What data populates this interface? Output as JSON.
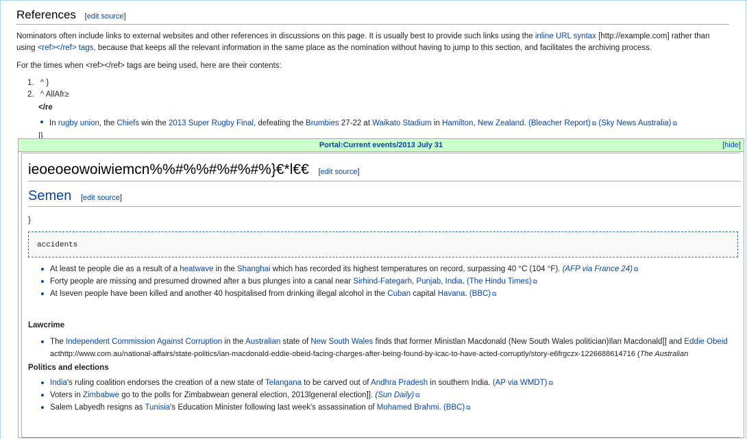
{
  "references": {
    "heading": "References",
    "edit_open": "[",
    "edit_label": "edit source",
    "edit_close": "]",
    "para1_a": "Nominators often include links to external websites and other references in discussions on this page. It is usually best to provide such links using the ",
    "para1_link1": "inline URL syntax",
    "para1_b": " [http://example.com] rather than using ",
    "para1_link2": "<ref></ref> tags",
    "para1_c": ", because that keeps all the relevant information in the same place as the nomination without having to jump to this section, and facilitates the archiving process.",
    "para2": "For the times when <ref></ref> tags are being used, here are their contents:",
    "ref1_num": "1.",
    "ref1_caret": "^",
    "ref1_text": " }",
    "ref2_num": "2.",
    "ref2_caret": "^",
    "ref2_text": " AllAfr≥",
    "ref2_bold": "</re",
    "bullet_a": "In ",
    "bullet_l1": "rugby union",
    "bullet_b": ", the ",
    "bullet_l2": "Chiefs",
    "bullet_c": " win the ",
    "bullet_l3": "2013 Super Rugby Final",
    "bullet_d": ", defeating the ",
    "bullet_l4": "Brumbies",
    "bullet_e": " 27-22 at ",
    "bullet_l5": "Waikato Stadium",
    "bullet_f": " in ",
    "bullet_l6": "Hamilton",
    "bullet_g": ", ",
    "bullet_l7": "New Zealand",
    "bullet_h": ". ",
    "bullet_l8": "(Bleacher Report)",
    "bullet_l9": "(Sky News Australia)",
    "closing": "|}"
  },
  "portal": {
    "title": "Portal:Current events/2013 July 31",
    "hide": "[hide]",
    "big_heading": "ieoeoeowoiwiemcn%%#%%#%#%#%}€*l€€",
    "edit_label": "edit source",
    "semen_heading": "Semen",
    "brace": "}",
    "pre_text": "accidents",
    "items": [
      {
        "a": "At least te people die as a result of a ",
        "l1": "heatwave",
        "b": " in the ",
        "l2": "Shanghai",
        "c": " which has recorded its highest temperatures on record, surpassing 40 °C (104 °F). ",
        "src": "(AFP via France 24)"
      },
      {
        "a": "Forty people are missing and presumed drowned after a bus plunges into a canal near ",
        "l1": "Sirhind-Fategarh",
        "b": ", ",
        "l2": "Punjab",
        "c": ", ",
        "l3": "India",
        "d": ". ",
        "src": "(The Hindu Times)"
      },
      {
        "a": "At lseven people have been killed and another 40 hospitalised from drinking illegal alcohol in the ",
        "l1": "Cuban",
        "b": " capital ",
        "l2": "Havana",
        "c": ". ",
        "src": "(BBC)"
      }
    ],
    "lawcrime_heading": "Lawcrime",
    "law": {
      "a": "The ",
      "l1": "Independent Commission Against Corruption",
      "b": " in the ",
      "l2": "Australian",
      "c": " state of ",
      "l3": "New South Wales",
      "d": " finds that former Ministlan Macdonald (New South Wales politician)Ilan Macdonald]] and ",
      "l4": "Eddie Obeid",
      "line2": "acthttp://www.com.au/national-affairs/state-politics/ian-macdonald-eddie-obeid-facing-charges-after-being-found-by-icac-to-have-acted-corruptly/story-e6frgczx-1226688614716 (",
      "line2_italic": "The Australian"
    },
    "politics_heading": "Politics and elections",
    "politics": [
      {
        "l1": "India",
        "a": "'s ruling coalition endorses the creation of a new state of ",
        "l2": "Telangana",
        "b": " to be carved out of ",
        "l3": "Andhra Pradesh",
        "c": " in southern India. ",
        "src": "(AP via WMDT)"
      },
      {
        "a": "Voters in ",
        "l1": "Zimbabwe",
        "b": " go to the polls for Zimbabwean general election, 2013lgeneral election]]. ",
        "src": "(Sun Daily)"
      },
      {
        "a": "Salem Labyedh resigns as ",
        "l1": "Tunisia",
        "b": "'s Education Minister following last week's assassination of ",
        "l2": "Mohamed Brahmi",
        "c": ". ",
        "src": "(BBC)"
      }
    ]
  },
  "icons": {
    "external_link": "external-link-icon"
  },
  "colors": {
    "link": "#0645ad",
    "portal_header_bg": "#ccffcc",
    "border": "#aaaaaa"
  }
}
